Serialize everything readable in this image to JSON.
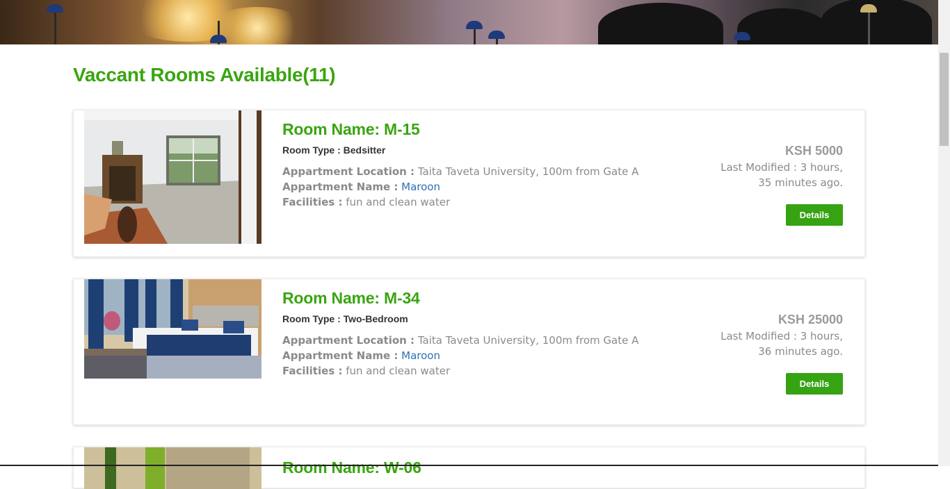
{
  "page": {
    "heading": "Vaccant Rooms Available(11)"
  },
  "labels": {
    "location": "Appartment Location :",
    "apartment": "Appartment Name :",
    "facilities": "Facilities :"
  },
  "rooms": [
    {
      "name": "Room Name: M-15",
      "type": "Room Type : Bedsitter",
      "location": "Taita Taveta University, 100m from Gate A",
      "apartment": "Maroon",
      "facilities": "fun and clean water",
      "price": "KSH 5000",
      "modified_line1": "Last Modified : 3 hours,",
      "modified_line2": "35 minutes ago.",
      "details_label": "Details"
    },
    {
      "name": "Room Name: M-34",
      "type": "Room Type : Two-Bedroom",
      "location": "Taita Taveta University, 100m from Gate A",
      "apartment": "Maroon",
      "facilities": "fun and clean water",
      "price": "KSH 25000",
      "modified_line1": "Last Modified : 3 hours,",
      "modified_line2": "36 minutes ago.",
      "details_label": "Details"
    },
    {
      "name": "Room Name: W-06"
    }
  ],
  "colors": {
    "accent": "#3aa510",
    "button": "#36a312",
    "link": "#2f6fb3",
    "muted": "#8a8a8a"
  }
}
